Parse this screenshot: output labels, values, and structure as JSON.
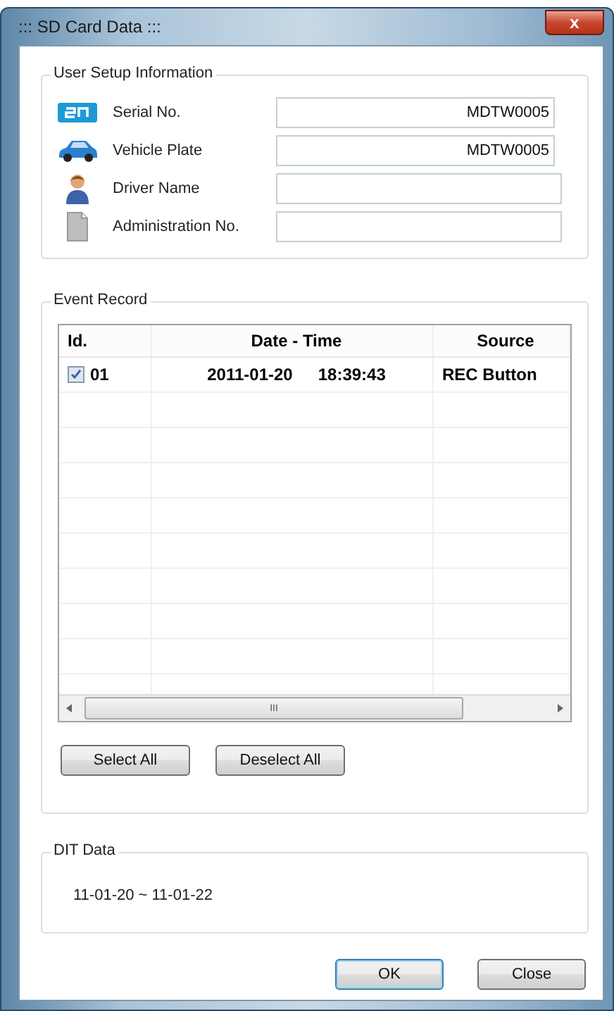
{
  "window": {
    "title": "::: SD Card Data :::",
    "close_glyph": "x"
  },
  "user_setup": {
    "title": "User Setup Information",
    "fields": [
      {
        "kind": "serial",
        "label": "Serial No.",
        "value": "MDTW0005"
      },
      {
        "kind": "vehicle",
        "label": "Vehicle Plate",
        "value": "MDTW0005"
      },
      {
        "kind": "driver",
        "label": "Driver Name"
      },
      {
        "kind": "document",
        "label": "Administration No."
      }
    ]
  },
  "event_record": {
    "title": "Event Record",
    "columns": [
      "Id.",
      "Date - Time",
      "Source"
    ],
    "rows": [
      {
        "id": "01",
        "date": "2011-01-20",
        "time": "18:39:43",
        "source": "REC Button",
        "checked": true
      }
    ],
    "scroll_thumb": "III",
    "buttons": [
      "Select All",
      "Deselect All"
    ]
  },
  "dit_data": {
    "title": "DIT Data",
    "range": "11-01-20 ~ 11-01-22"
  },
  "buttons": [
    {
      "label": "OK",
      "default": true
    },
    {
      "label": "Close",
      "default": false
    }
  ]
}
